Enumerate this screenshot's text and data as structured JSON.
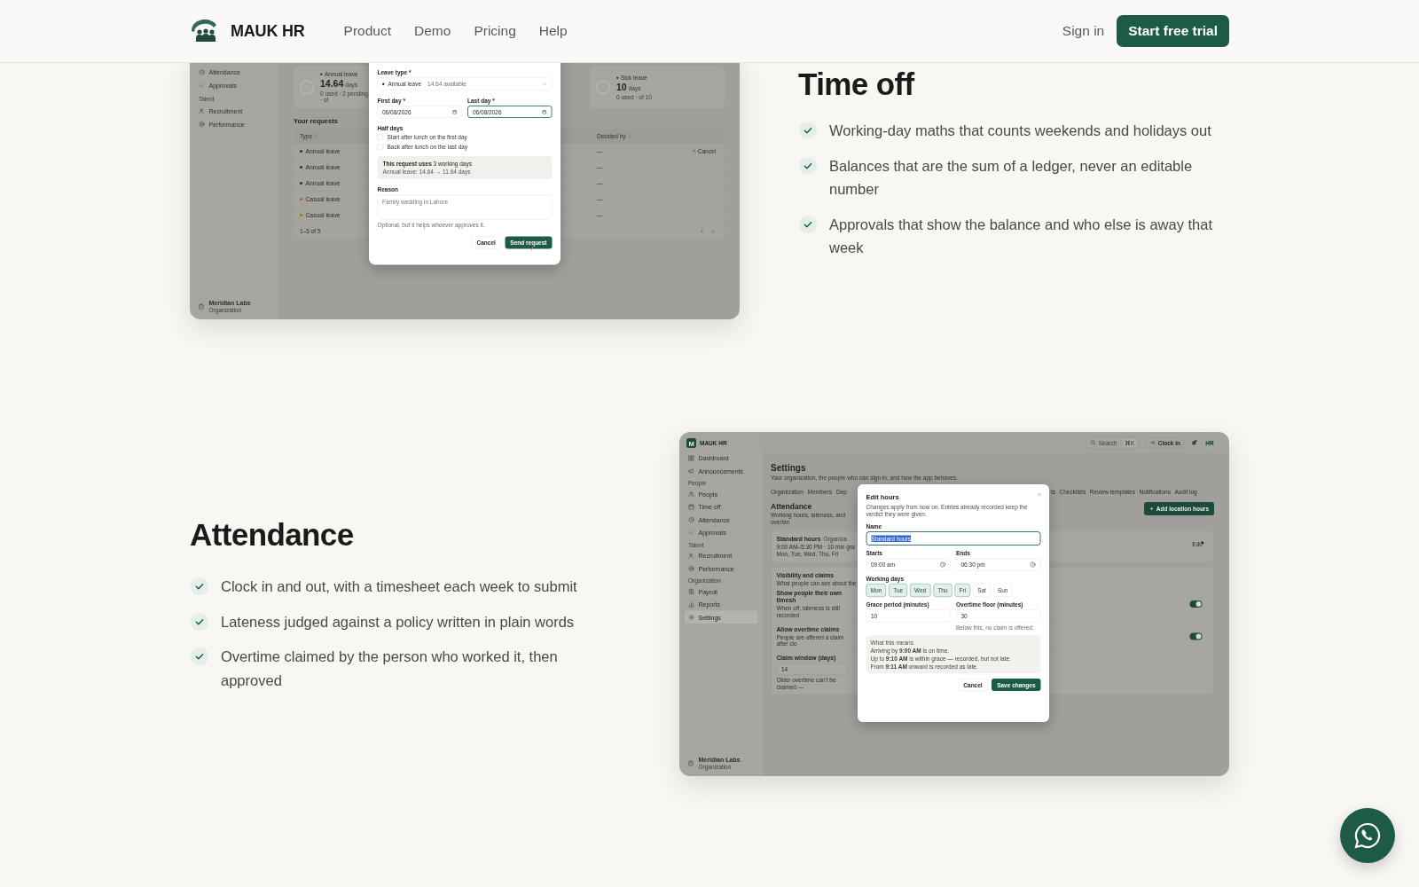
{
  "header": {
    "brand": "MAUK HR",
    "links": [
      {
        "label": "Product"
      },
      {
        "label": "Demo"
      },
      {
        "label": "Pricing"
      },
      {
        "label": "Help"
      }
    ],
    "sign_in": "Sign in",
    "cta": "Start free trial"
  },
  "time_off": {
    "title": "Time off",
    "points": [
      "Working-day maths that counts weekends and holidays out",
      "Balances that are the sum of a ledger, never an editable number",
      "Approvals that show the balance and who else is away that week"
    ],
    "app": {
      "sidebar": [
        {
          "kind": "link",
          "label": "Attendance",
          "selected": false
        },
        {
          "kind": "link",
          "label": "Approvals",
          "selected": false
        },
        {
          "kind": "heading",
          "label": "Talent"
        },
        {
          "kind": "link",
          "label": "Recruitment",
          "selected": false
        },
        {
          "kind": "link",
          "label": "Performance",
          "selected": false
        }
      ],
      "org": {
        "name": "Meridian Labs",
        "caption": "Organization"
      },
      "balances": [
        {
          "type": "Annual leave",
          "value": "14.64",
          "unit": "days",
          "caption": "0 used · 2 pending · of"
        },
        {
          "type": "Sick leave",
          "value": "10",
          "unit": "days",
          "caption": "0 used · of 10"
        }
      ],
      "requests": {
        "title": "Your requests",
        "columns": [
          "Type",
          "Decided by"
        ],
        "rows": [
          {
            "type": "Annual leave",
            "color": "#2e2e2c",
            "decided_by": "—",
            "action": "Cancel"
          },
          {
            "type": "Annual leave",
            "color": "#2e2e2c",
            "decided_by": "—"
          },
          {
            "type": "Annual leave",
            "color": "#2e2e2c",
            "decided_by": "—"
          },
          {
            "type": "Casual leave",
            "color": "#a8661c",
            "decided_by": "—"
          },
          {
            "type": "Casual leave",
            "color": "#a8661c",
            "decided_by": "—"
          }
        ],
        "footer": "1–5 of 5"
      },
      "modal": {
        "leave_type": {
          "label": "Leave type *",
          "value": "Annual leave",
          "hint": "14.64 available"
        },
        "first_day": {
          "label": "First day *",
          "value": "06/08/2026",
          "focused": false
        },
        "last_day": {
          "label": "Last day *",
          "value": "06/08/2026",
          "focused": true
        },
        "half_days": {
          "label": "Half days",
          "options": [
            {
              "label": "Start after lunch on the first day",
              "checked": false
            },
            {
              "label": "Back after lunch on the last day",
              "checked": false
            }
          ]
        },
        "summary": {
          "text": "**This request uses** 3 working days",
          "detail": "Annual leave: 14.64 → 11.64 days"
        },
        "reason": {
          "label": "Reason",
          "placeholder": "Family wedding in Lahore",
          "hint": "Optional, but it helps whoever approves it."
        },
        "buttons": [
          {
            "label": "Cancel",
            "kind": "secondary"
          },
          {
            "label": "Send request",
            "kind": "primary"
          }
        ]
      }
    }
  },
  "attendance": {
    "title": "Attendance",
    "points": [
      "Clock in and out, with a timesheet each week to submit",
      "Lateness judged against a policy written in plain words",
      "Overtime claimed by the person who worked it, then approved"
    ],
    "app": {
      "brand_mark": "M",
      "brand": "MAUK HR",
      "sidebar": [
        {
          "kind": "link",
          "label": "Dashboard",
          "selected": false
        },
        {
          "kind": "link",
          "label": "Announcements",
          "selected": false
        },
        {
          "kind": "heading",
          "label": "People"
        },
        {
          "kind": "link",
          "label": "People",
          "selected": false
        },
        {
          "kind": "link",
          "label": "Time off",
          "selected": false
        },
        {
          "kind": "link",
          "label": "Attendance",
          "selected": false
        },
        {
          "kind": "link",
          "label": "Approvals",
          "selected": false
        },
        {
          "kind": "heading",
          "label": "Talent"
        },
        {
          "kind": "link",
          "label": "Recruitment",
          "selected": false
        },
        {
          "kind": "link",
          "label": "Performance",
          "selected": false
        },
        {
          "kind": "heading",
          "label": "Organization"
        },
        {
          "kind": "link",
          "label": "Payroll",
          "selected": false
        },
        {
          "kind": "link",
          "label": "Reports",
          "selected": false
        },
        {
          "kind": "link",
          "label": "Settings",
          "selected": true
        }
      ],
      "org": {
        "name": "Meridian Labs",
        "caption": "Organization"
      },
      "topbar": {
        "search": {
          "placeholder": "Search",
          "shortcut": "⌘K"
        },
        "clock_in": "Clock in",
        "avatar": "HR"
      },
      "page": {
        "title": "Settings",
        "subtitle": "Your organization, the people who can sign in, and how the app behaves."
      },
      "tabs_left": [
        {
          "label": "Organization",
          "selected": false
        },
        {
          "label": "Members",
          "selected": false
        },
        {
          "label": "Dep",
          "selected": false
        }
      ],
      "tabs_right": [
        {
          "label": "ts",
          "selected": false
        },
        {
          "label": "Checklists",
          "selected": false
        },
        {
          "label": "Review templates",
          "selected": false
        },
        {
          "label": "Notifications",
          "selected": false
        },
        {
          "label": "Audit log",
          "selected": false
        }
      ],
      "section": {
        "title": "Attendance",
        "subtitle": "Working hours, lateness, and overtim",
        "add_button": "Add location hours"
      },
      "hours_card": {
        "name": "Standard hours",
        "badge": "Organiza",
        "time": "9:00 AM–5:30 PM · 10 min gra",
        "days": "Mon, Tue, Wed, Thu, Fri",
        "edit": "Edit"
      },
      "visibility_card": {
        "title": "Visibility and claims",
        "subtitle": "What people can see about the",
        "settings": [
          {
            "label": "Show people their own timesh",
            "description": "When off, lateness is still recorded",
            "on": true
          },
          {
            "label": "Allow overtime claims",
            "description": "People are offered a claim after clo",
            "on": true
          }
        ],
        "claim_window": {
          "label": "Claim window (days)",
          "value": "14",
          "hint": "Older overtime can't be claimed —"
        }
      },
      "modal": {
        "title": "Edit hours",
        "description": "Changes apply from now on. Entries already recorded keep the verdict they were given.",
        "name": {
          "label": "Name",
          "value": "Standard hours",
          "text_selected": true
        },
        "starts": {
          "label": "Starts",
          "value": "09:00 am"
        },
        "ends": {
          "label": "Ends",
          "value": "06:30 pm"
        },
        "working_days": {
          "label": "Working days",
          "days": [
            {
              "label": "Mon",
              "selected": true
            },
            {
              "label": "Tue",
              "selected": true
            },
            {
              "label": "Wed",
              "selected": true
            },
            {
              "label": "Thu",
              "selected": true
            },
            {
              "label": "Fri",
              "selected": true
            },
            {
              "label": "Sat",
              "selected": false
            },
            {
              "label": "Sun",
              "selected": false
            }
          ]
        },
        "grace": {
          "label": "Grace period (minutes)",
          "value": "10"
        },
        "overtime": {
          "label": "Overtime floor (minutes)",
          "value": "30",
          "hint": "Below this, no claim is offered."
        },
        "info": {
          "title": "What this means",
          "lines": [
            "Arriving by **9:00 AM** is on time.",
            "Up to **9:10 AM** is within grace — recorded, but not late.",
            "From **9:11 AM** onward is recorded as late."
          ]
        },
        "buttons": [
          {
            "label": "Cancel",
            "kind": "secondary"
          },
          {
            "label": "Save changes",
            "kind": "primary"
          }
        ]
      }
    }
  }
}
